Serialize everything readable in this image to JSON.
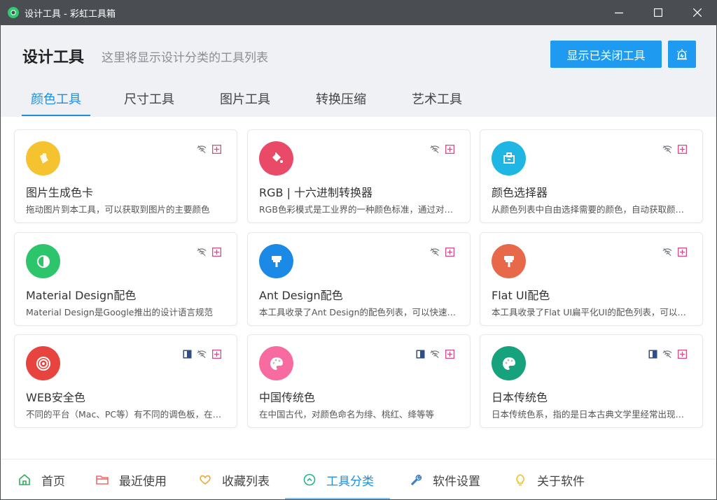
{
  "window": {
    "title": "设计工具 - 彩虹工具箱",
    "controls": [
      "minimize-icon",
      "maximize-icon",
      "close-icon"
    ]
  },
  "header": {
    "title": "设计工具",
    "subtitle": "这里将显示设计分类的工具列表",
    "show_closed_label": "显示已关闭工具",
    "bell_icon": "alarm-icon"
  },
  "tabs": [
    {
      "label": "颜色工具",
      "active": true
    },
    {
      "label": "尺寸工具",
      "active": false
    },
    {
      "label": "图片工具",
      "active": false
    },
    {
      "label": "转换压缩",
      "active": false
    },
    {
      "label": "艺术工具",
      "active": false
    }
  ],
  "cards": [
    {
      "title": "图片生成色卡",
      "desc": "拖动图片到本工具，可以获取到图片的主要颜色",
      "icon": "palette-card-icon",
      "color": "#f5c330",
      "offline": true,
      "book": false
    },
    {
      "title": "RGB | 十六进制转换器",
      "desc": "RGB色彩模式是工业界的一种颜色标准，通过对红绿蓝三个颜色通道的变化",
      "icon": "paint-bucket-icon",
      "color": "#e94a68",
      "offline": true,
      "book": false
    },
    {
      "title": "颜色选择器",
      "desc": "从颜色列表中自由选择需要的颜色，自动获取颜色值",
      "icon": "color-picker-icon",
      "color": "#1fb6e4",
      "offline": true,
      "book": false
    },
    {
      "title": "Material Design配色",
      "desc": "Material Design是Google推出的设计语言规范",
      "icon": "contrast-icon",
      "color": "#2dc56b",
      "offline": true,
      "book": false
    },
    {
      "title": "Ant Design配色",
      "desc": "本工具收录了Ant Design的配色列表，可以快速复制",
      "icon": "paint-roller-icon",
      "color": "#1b8ae6",
      "offline": true,
      "book": false
    },
    {
      "title": "Flat UI配色",
      "desc": "本工具收录了Flat UI扁平化UI的配色列表，可以快速复制",
      "icon": "paint-roller-icon",
      "color": "#e8694a",
      "offline": true,
      "book": false
    },
    {
      "title": "WEB安全色",
      "desc": "不同的平台（Mac、PC等）有不同的调色板，在不同的浏览器中",
      "icon": "target-icon",
      "color": "#e8443f",
      "offline": true,
      "book": true
    },
    {
      "title": "中国传统色",
      "desc": "在中国古代，对颜色命名为绯、桃红、绛等等",
      "icon": "palette-icon",
      "color": "#f76ba0",
      "offline": true,
      "book": true
    },
    {
      "title": "日本传统色",
      "desc": "日本传统色系，指的是日本古典文学里经常出现的颜色",
      "icon": "palette-icon",
      "color": "#16a27c",
      "offline": true,
      "book": true
    }
  ],
  "colors": {
    "accent": "#1e9bf0",
    "card_action_pink": "#d94b8a",
    "card_action_gray": "#777b80",
    "book_blue": "#2f4e86"
  },
  "bottom_nav": [
    {
      "label": "首页",
      "icon": "home-icon",
      "active": false
    },
    {
      "label": "最近使用",
      "icon": "folder-icon",
      "active": false
    },
    {
      "label": "收藏列表",
      "icon": "heart-icon",
      "active": false
    },
    {
      "label": "工具分类",
      "icon": "category-icon",
      "active": true
    },
    {
      "label": "软件设置",
      "icon": "wrench-icon",
      "active": false
    },
    {
      "label": "关于软件",
      "icon": "lightbulb-icon",
      "active": false
    }
  ]
}
